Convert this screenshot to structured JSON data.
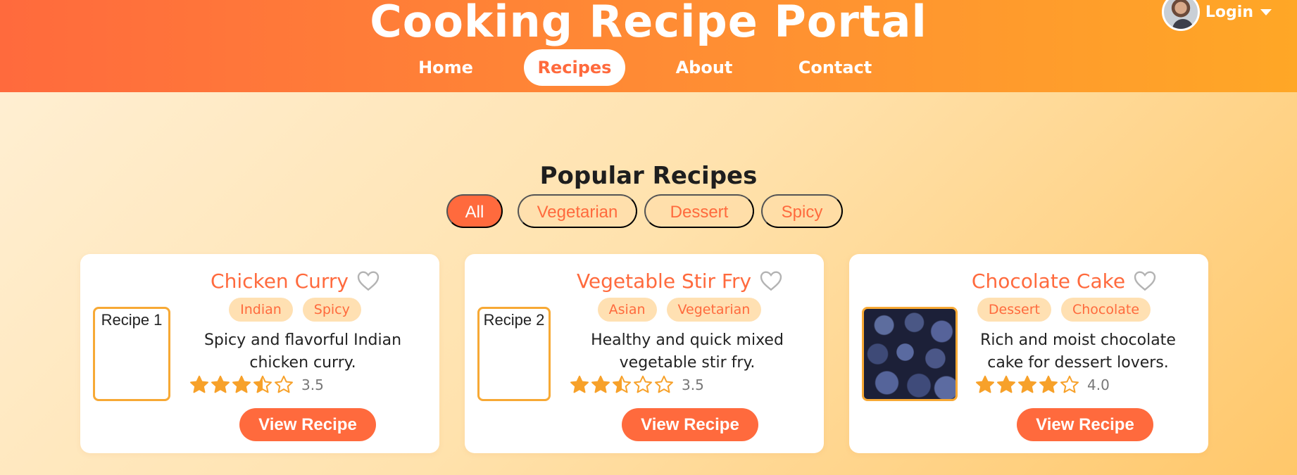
{
  "header": {
    "title": "Cooking Recipe Portal",
    "nav": [
      "Home",
      "Recipes",
      "About",
      "Contact"
    ],
    "active_nav": "Recipes",
    "login_label": "Login"
  },
  "section": {
    "title": "Popular Recipes",
    "filters": [
      "All",
      "Vegetarian",
      "Dessert",
      "Spicy"
    ],
    "active_filter": "All"
  },
  "recipes": [
    {
      "title": "Chicken Curry",
      "image_alt": "Recipe 1",
      "image_loaded": false,
      "tags": [
        "Indian",
        "Spicy"
      ],
      "description": "Spicy and flavorful Indian chicken curry.",
      "rating": 3.5,
      "rating_text": "3.5",
      "button": "View Recipe"
    },
    {
      "title": "Vegetable Stir Fry",
      "image_alt": "Recipe 2",
      "image_loaded": false,
      "tags": [
        "Asian",
        "Vegetarian"
      ],
      "description": "Healthy and quick mixed vegetable stir fry.",
      "rating": 2.5,
      "rating_text": "3.5",
      "button": "View Recipe"
    },
    {
      "title": "Chocolate Cake",
      "image_alt": "",
      "image_loaded": true,
      "tags": [
        "Dessert",
        "Chocolate"
      ],
      "description": "Rich and moist chocolate cake for dessert lovers.",
      "rating": 4.0,
      "rating_text": "4.0",
      "button": "View Recipe"
    }
  ],
  "colors": {
    "accent": "#ff6a3d",
    "star": "#f7a12a",
    "tag_bg": "#ffe0b2"
  },
  "icons": {
    "favorite": "heart-outline-icon",
    "rating_full": "star-full-icon",
    "rating_half": "star-half-icon",
    "rating_empty": "star-outline-icon",
    "dropdown": "caret-down-icon"
  }
}
